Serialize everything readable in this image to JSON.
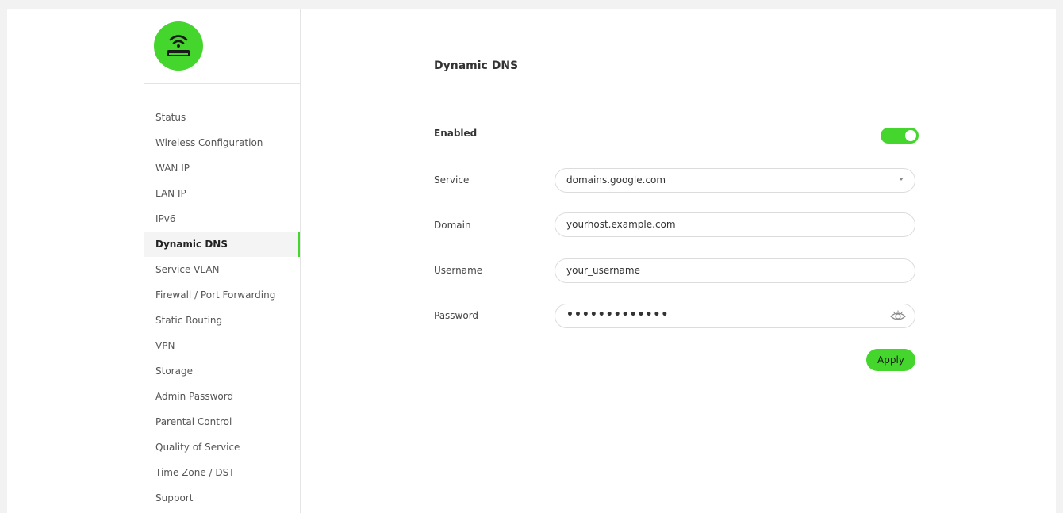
{
  "colors": {
    "accent": "#44d62c",
    "background": "#ffffff",
    "page_background": "#f2f2f2"
  },
  "logo": {
    "icon": "router-wifi-icon"
  },
  "sidebar": {
    "items": [
      {
        "label": "Status",
        "active": false
      },
      {
        "label": "Wireless Configuration",
        "active": false
      },
      {
        "label": "WAN IP",
        "active": false
      },
      {
        "label": "LAN IP",
        "active": false
      },
      {
        "label": "IPv6",
        "active": false
      },
      {
        "label": "Dynamic DNS",
        "active": true
      },
      {
        "label": "Service VLAN",
        "active": false
      },
      {
        "label": "Firewall / Port Forwarding",
        "active": false
      },
      {
        "label": "Static Routing",
        "active": false
      },
      {
        "label": "VPN",
        "active": false
      },
      {
        "label": "Storage",
        "active": false
      },
      {
        "label": "Admin Password",
        "active": false
      },
      {
        "label": "Parental Control",
        "active": false
      },
      {
        "label": "Quality of Service",
        "active": false
      },
      {
        "label": "Time Zone / DST",
        "active": false
      },
      {
        "label": "Support",
        "active": false
      }
    ]
  },
  "main": {
    "title": "Dynamic DNS",
    "enabled": {
      "label": "Enabled",
      "value": true
    },
    "service": {
      "label": "Service",
      "value": "domains.google.com",
      "icon": "chevron-down-icon"
    },
    "domain": {
      "label": "Domain",
      "value": "yourhost.example.com"
    },
    "username": {
      "label": "Username",
      "value": "your_username"
    },
    "password": {
      "label": "Password",
      "value": "•••••••••••••",
      "icon": "eye-icon"
    },
    "apply_label": "Apply"
  }
}
